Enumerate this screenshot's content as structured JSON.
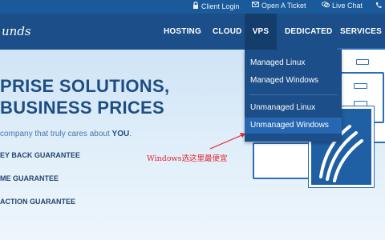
{
  "topbar": {
    "client_login": "Client Login",
    "open_ticket": "Open A Ticket",
    "live_chat": "Live Chat"
  },
  "logo": {
    "text": "unds"
  },
  "nav": {
    "hosting": "HOSTING",
    "cloud": "CLOUD",
    "vps": "VPS",
    "dedicated": "DEDICATED",
    "services": "SERVICES"
  },
  "vps_menu": {
    "items": [
      "Managed Linux",
      "Managed Windows",
      "Unmanaged Linux",
      "Unmanaged Windows"
    ],
    "highlighted": "Unmanaged Windows"
  },
  "hero": {
    "title_line1": "PRISE SOLUTIONS,",
    "title_line2": "BUSINESS PRICES",
    "subtitle_pre": "company that truly cares about ",
    "subtitle_emph": "YOU",
    "subtitle_post": ".",
    "features": [
      "EY BACK GUARANTEE",
      "ME GUARANTEE",
      "ACTION GUARANTEE"
    ]
  },
  "annotation": {
    "text": "Windows选这里最便宜",
    "color": "#e0242b"
  },
  "colors": {
    "nav_bg": "#1c4f89",
    "topbar_bg": "#1a5a9b",
    "highlight": "#2766b0",
    "hero_text": "#1d4d83"
  },
  "icons": {
    "client_login": "lock-icon",
    "open_ticket": "ticket-icon",
    "live_chat": "chat-icon",
    "phone": "phone-icon"
  }
}
